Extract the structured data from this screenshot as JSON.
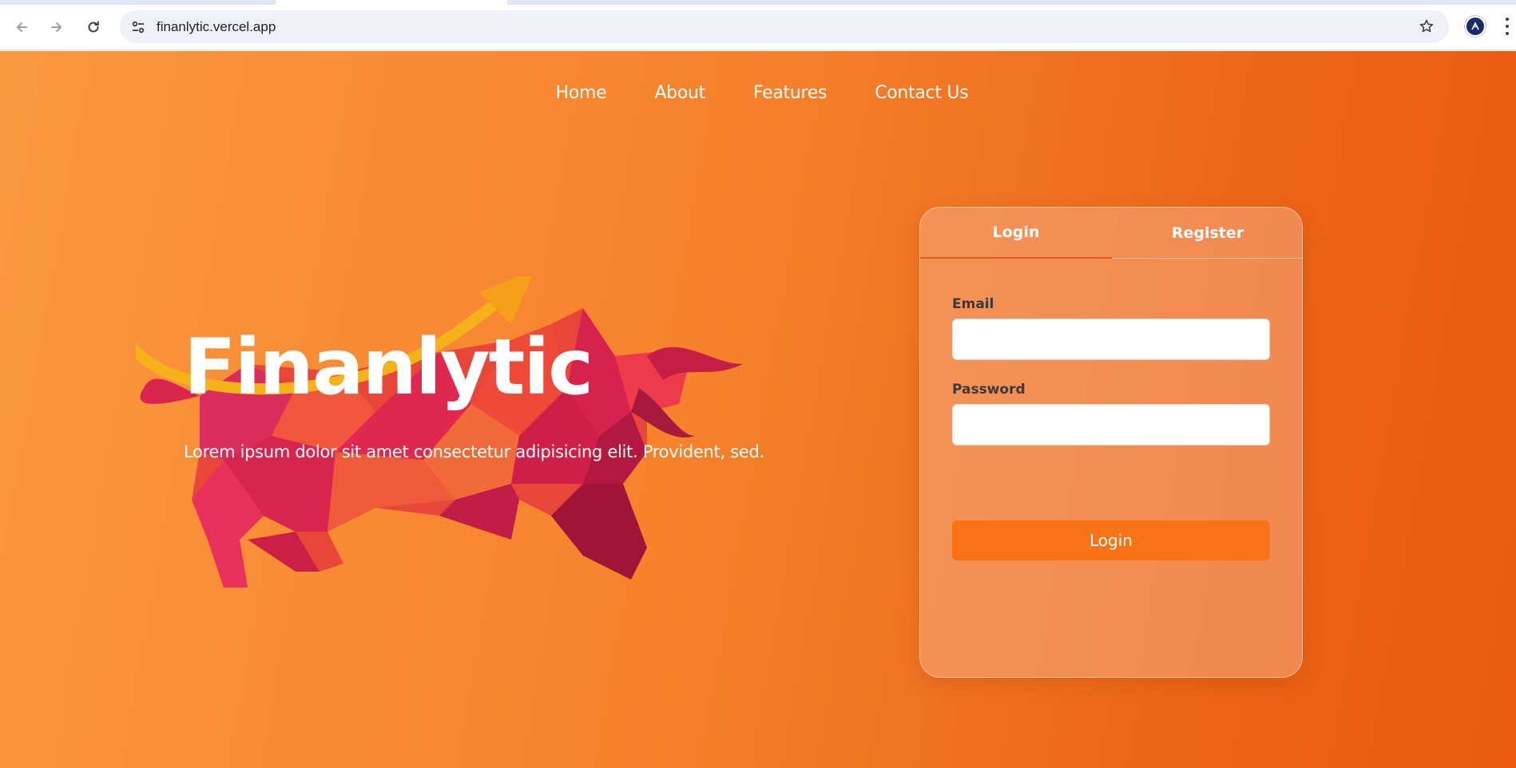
{
  "browser": {
    "url": "finanlytic.vercel.app"
  },
  "nav": {
    "items": [
      {
        "label": "Home"
      },
      {
        "label": "About"
      },
      {
        "label": "Features"
      },
      {
        "label": "Contact Us"
      }
    ]
  },
  "hero": {
    "title": "Finanlytic",
    "subtitle": "Lorem ipsum dolor sit amet consectetur adipisicing elit. Provident, sed."
  },
  "auth": {
    "tabs": [
      {
        "label": "Login",
        "active": true
      },
      {
        "label": "Register",
        "active": false
      }
    ],
    "email_label": "Email",
    "email_value": "",
    "password_label": "Password",
    "password_value": "",
    "submit_label": "Login"
  },
  "colors": {
    "accent": "#f97316",
    "gradient_start": "#fb9840",
    "gradient_end": "#e95a10"
  },
  "icons": {
    "back": "arrow-left-icon",
    "forward": "arrow-right-icon",
    "reload": "reload-icon",
    "site_info": "tune-icon",
    "bookmark": "star-icon",
    "menu": "kebab-menu-icon",
    "logo": "bull-logo"
  }
}
